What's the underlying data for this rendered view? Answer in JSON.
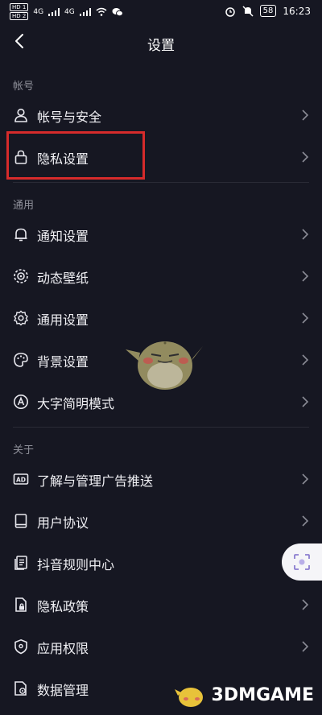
{
  "status": {
    "left_badges": [
      "HD 1",
      "HD 2"
    ],
    "network": [
      "4G",
      "4G"
    ],
    "battery": "58",
    "time": "16:23"
  },
  "header": {
    "title": "设置"
  },
  "sections": {
    "account": "帐号",
    "general": "通用",
    "about": "关于"
  },
  "items": {
    "account_security": "帐号与安全",
    "privacy_settings": "隐私设置",
    "notifications": "通知设置",
    "live_wallpaper": "动态壁纸",
    "general_settings": "通用设置",
    "background_settings": "背景设置",
    "large_text_mode": "大字简明模式",
    "ad_management": "了解与管理广告推送",
    "user_agreement": "用户协议",
    "rules_center": "抖音规则中心",
    "privacy_policy": "隐私政策",
    "app_permissions": "应用权限",
    "data_management": "数据管理"
  },
  "watermark": "3DMGAME",
  "colors": {
    "background": "#161722",
    "highlight": "#d62b2b",
    "section_text": "#8f909a"
  }
}
